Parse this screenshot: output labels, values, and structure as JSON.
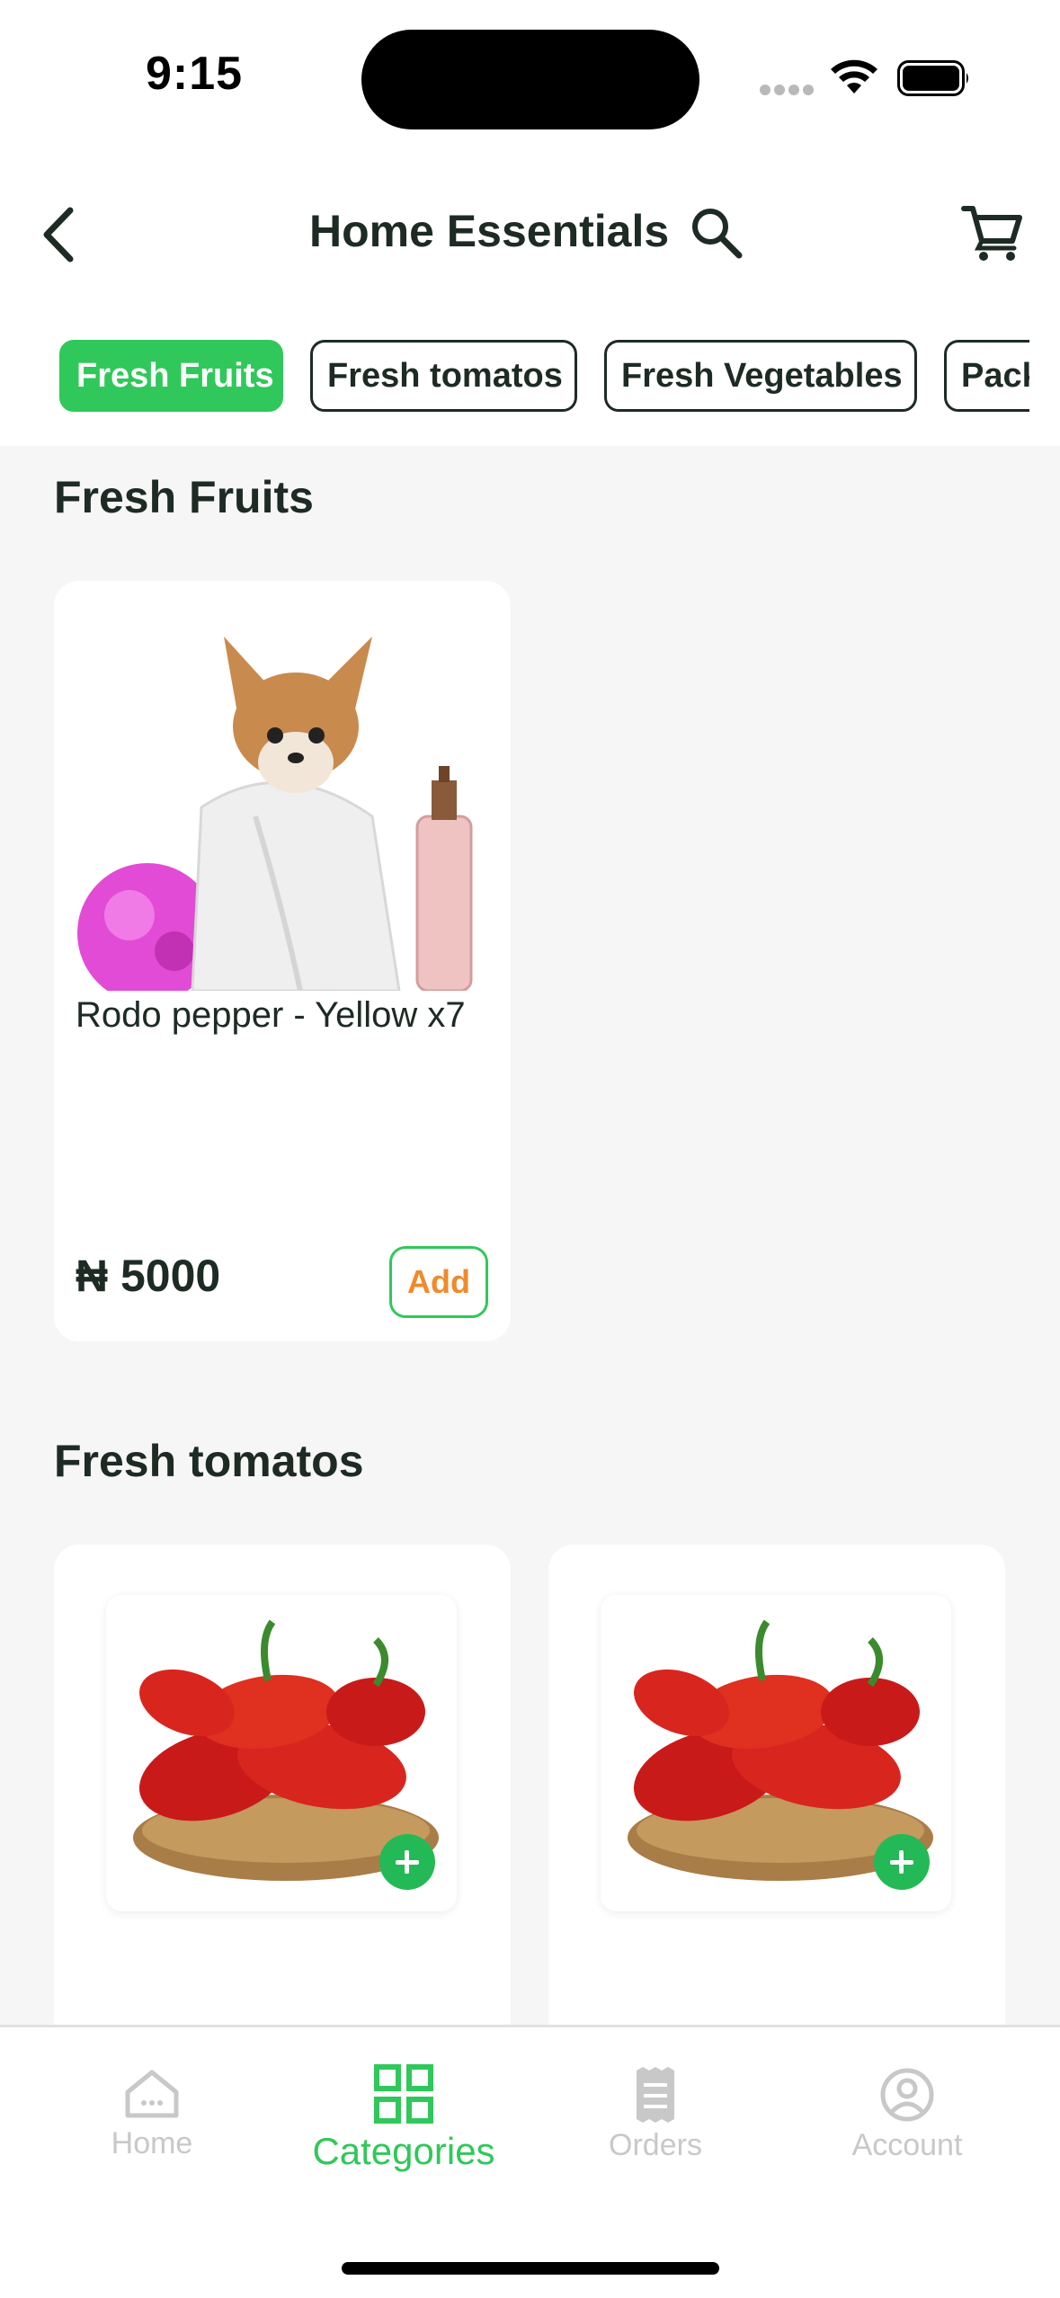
{
  "status_bar": {
    "time": "9:15"
  },
  "header": {
    "title": "Home Essentials"
  },
  "chips": [
    {
      "label": "Fresh Fruits",
      "active": true
    },
    {
      "label": "Fresh tomatos",
      "active": false
    },
    {
      "label": "Fresh Vegetables",
      "active": false
    },
    {
      "label": "Packaged",
      "active": false
    }
  ],
  "sections": [
    {
      "title": "Fresh Fruits",
      "products": [
        {
          "name": "Rodo pepper - Yellow x7",
          "price": "₦ 5000",
          "add_label": "Add"
        }
      ]
    },
    {
      "title": "Fresh tomatos",
      "products": [
        {
          "name": ""
        },
        {
          "name": ""
        }
      ]
    }
  ],
  "bottom_nav": [
    {
      "label": "Home",
      "icon": "home-icon",
      "active": false
    },
    {
      "label": "Categories",
      "icon": "grid-icon",
      "active": true
    },
    {
      "label": "Orders",
      "icon": "receipt-icon",
      "active": false
    },
    {
      "label": "Account",
      "icon": "user-circle-icon",
      "active": false
    }
  ],
  "colors": {
    "accent": "#30c85a",
    "add_text": "#f08a2c",
    "text": "#1d2b24",
    "background": "#f6f6f6"
  }
}
